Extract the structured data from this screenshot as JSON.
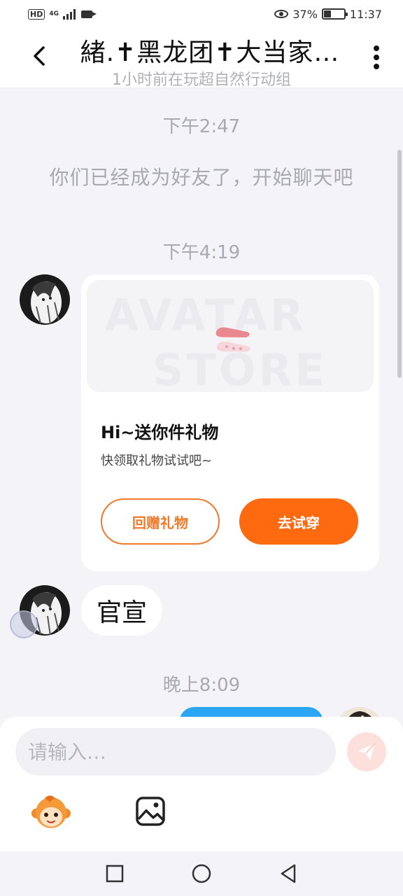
{
  "status_bar": {
    "network_hd": "HD",
    "network_type": "4G",
    "battery_percent": "37%",
    "battery_level": 0.37,
    "time": "11:37"
  },
  "header": {
    "title": "緒.✝黑龙团✝大当家…",
    "subtitle": "1小时前在玩超自然行动组",
    "back_icon": "chevron-left-icon",
    "more_icon": "vertical-dots-icon"
  },
  "messages": {
    "time1": "下午2:47",
    "system_text": "你们已经成为好友了，开始聊天吧",
    "time2": "下午4:19",
    "gift_card": {
      "banner_watermark_line1": "AVATAR",
      "banner_watermark_line2": "STORE",
      "title": "Hi~送你件礼物",
      "description": "快领取礼物试试吧~",
      "return_gift_label": "回赠礼物",
      "try_on_label": "去试穿"
    },
    "text_message": "官宣",
    "time3": "晚上8:09"
  },
  "input": {
    "placeholder": "请输入…",
    "send_icon": "paper-plane-icon",
    "emoji_icon": "monkey-emoji-icon",
    "image_icon": "image-icon"
  },
  "nav": {
    "recent_icon": "square-icon",
    "home_icon": "circle-icon",
    "back_icon": "triangle-back-icon"
  },
  "colors": {
    "accent_orange": "#fe6a10",
    "outgoing_bubble": "#2aa6f5",
    "background": "#f3f3f8"
  }
}
